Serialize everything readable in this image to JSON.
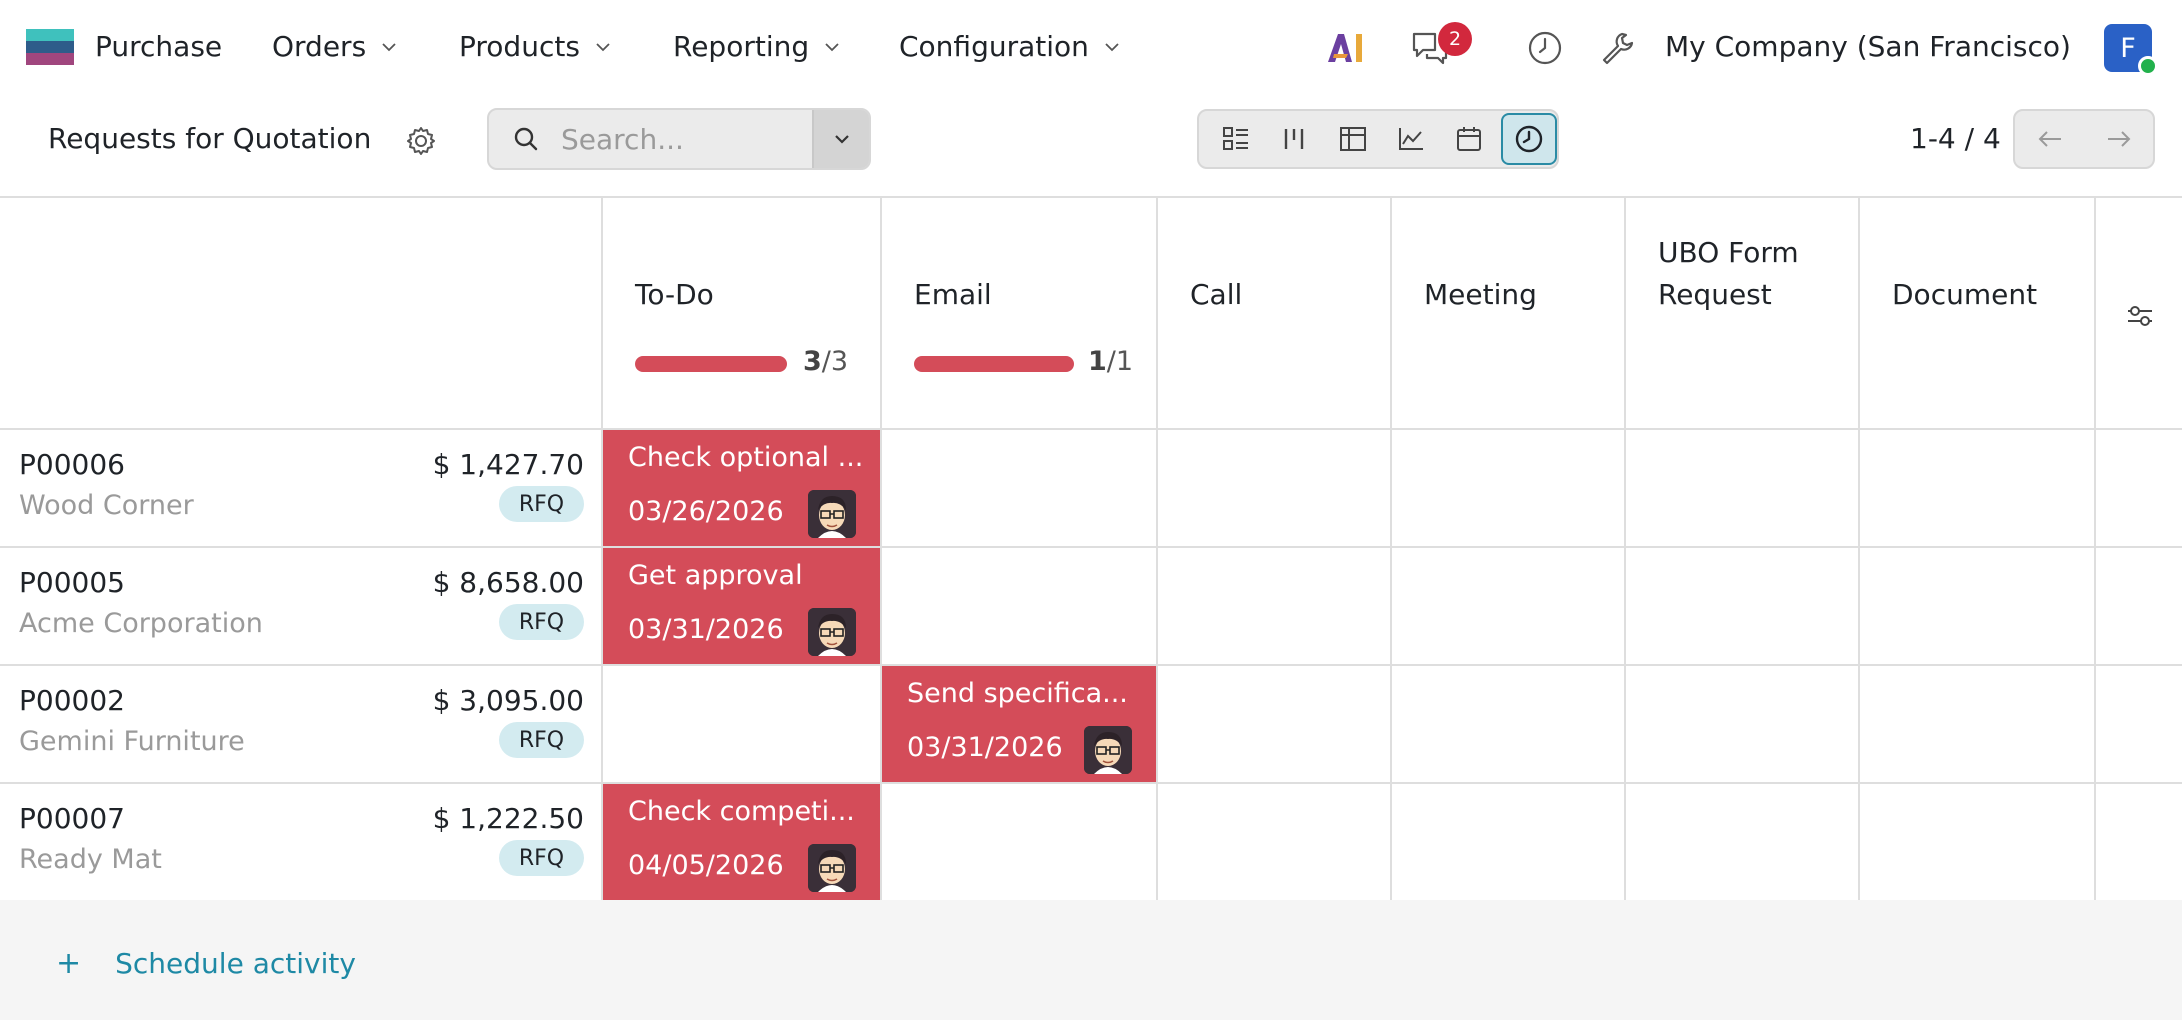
{
  "navbar": {
    "app_name": "Purchase",
    "menus": [
      {
        "label": "Orders"
      },
      {
        "label": "Products"
      },
      {
        "label": "Reporting"
      },
      {
        "label": "Configuration"
      }
    ],
    "messages_badge": "2",
    "company": "My Company (San Francisco)",
    "user_initial": "F",
    "ai_label": "AI"
  },
  "control": {
    "title": "Requests for Quotation",
    "search_placeholder": "Search...",
    "pager": "1-4 / 4",
    "views": [
      "list-view-icon",
      "kanban-view-icon",
      "pivot-view-icon",
      "graph-view-icon",
      "calendar-view-icon",
      "activity-view-icon"
    ],
    "active_view": "activity-view-icon"
  },
  "columns": [
    {
      "title": "To-Do",
      "done": 3,
      "total": 3,
      "count_done": "3",
      "count_total": "/3"
    },
    {
      "title": "Email",
      "done": 1,
      "total": 1,
      "count_done": "1",
      "count_total": "/1"
    },
    {
      "title": "Call"
    },
    {
      "title": "Meeting"
    },
    {
      "title": "UBO Form",
      "title2": "Request"
    },
    {
      "title": "Document"
    }
  ],
  "rows": [
    {
      "name": "P00006",
      "partner": "Wood Corner",
      "amount": "$ 1,427.70",
      "status": "RFQ",
      "activity": {
        "column": "To-Do",
        "summary": "Check optional ...",
        "date": "03/26/2026"
      }
    },
    {
      "name": "P00005",
      "partner": "Acme Corporation",
      "amount": "$ 8,658.00",
      "status": "RFQ",
      "activity": {
        "column": "To-Do",
        "summary": "Get approval",
        "date": "03/31/2026"
      }
    },
    {
      "name": "P00002",
      "partner": "Gemini Furniture",
      "amount": "$ 3,095.00",
      "status": "RFQ",
      "activity": {
        "column": "Email",
        "summary": "Send specifica...",
        "date": "03/31/2026"
      }
    },
    {
      "name": "P00007",
      "partner": "Ready Mat",
      "amount": "$ 1,222.50",
      "status": "RFQ",
      "activity": {
        "column": "To-Do",
        "summary": "Check competi...",
        "date": "04/05/2026"
      }
    }
  ],
  "footer": {
    "schedule_label": "Schedule activity"
  },
  "colors": {
    "activity_overdue": "#d44c59",
    "accent": "#1e89a5",
    "badge": "#d2283d"
  }
}
